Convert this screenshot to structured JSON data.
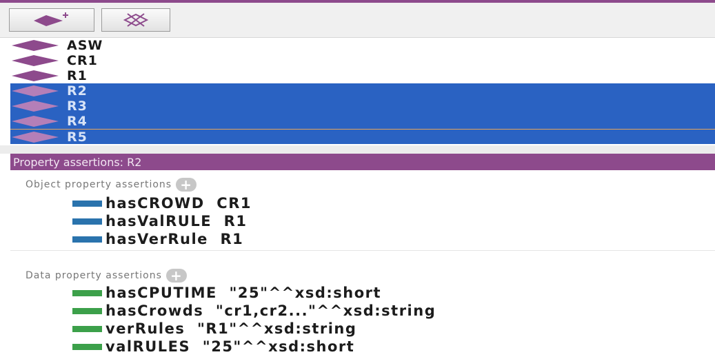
{
  "colors": {
    "accent_purple": "#8d4a8c",
    "selection_blue": "#2a62c2",
    "individual_diamond": "#8d4a8c",
    "object_property": "#2a73ad",
    "data_property": "#3ca04a"
  },
  "toolbar": {
    "add_icon": "add-individual-icon",
    "delete_icon": "delete-individual-icon"
  },
  "individuals": [
    {
      "label": "ASW",
      "selected": false
    },
    {
      "label": "CR1",
      "selected": false
    },
    {
      "label": "R1",
      "selected": false
    },
    {
      "label": "R2",
      "selected": true
    },
    {
      "label": "R3",
      "selected": true
    },
    {
      "label": "R4",
      "selected": true
    },
    {
      "label": "R5",
      "selected": true
    }
  ],
  "property_assertions": {
    "header": "Property assertions: R2",
    "object_section": {
      "title": "Object property assertions",
      "items": [
        {
          "property": "hasCROWD",
          "value": "CR1"
        },
        {
          "property": "hasValRULE",
          "value": "R1"
        },
        {
          "property": "hasVerRule",
          "value": "R1"
        }
      ]
    },
    "data_section": {
      "title": "Data property assertions",
      "items": [
        {
          "property": "hasCPUTIME",
          "value": "\"25\"^^xsd:short"
        },
        {
          "property": "hasCrowds",
          "value": "\"cr1,cr2...\"^^xsd:string"
        },
        {
          "property": "verRules",
          "value": "\"R1\"^^xsd:string"
        },
        {
          "property": "valRULES",
          "value": "\"25\"^^xsd:short"
        }
      ]
    }
  }
}
